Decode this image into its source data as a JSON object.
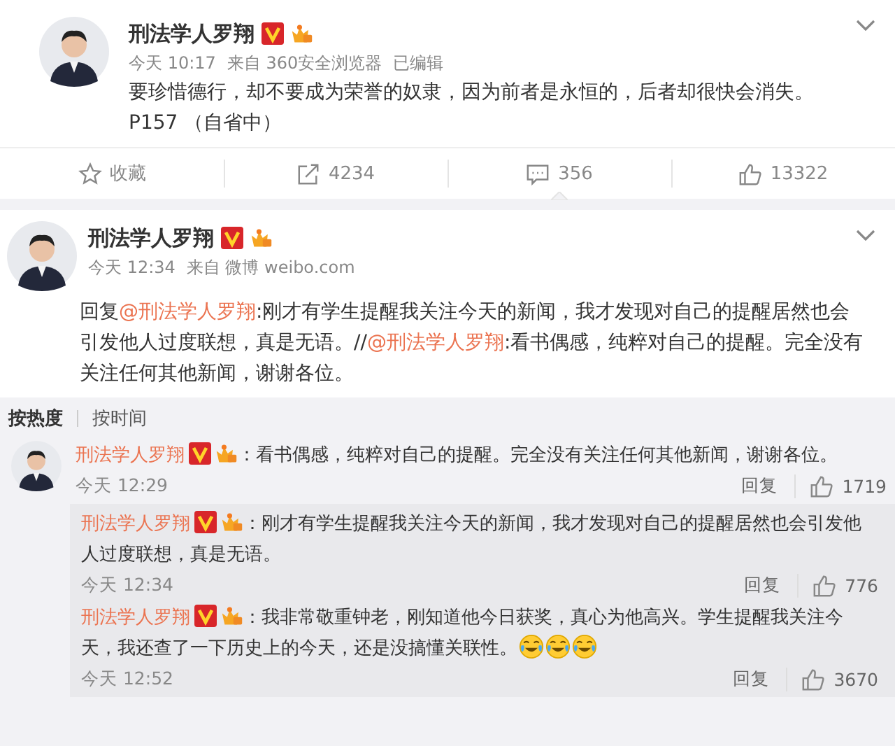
{
  "post": {
    "author": "刑法学人罗翔",
    "time": "今天 10:17",
    "source": "来自 360安全浏览器",
    "edited": "已编辑",
    "lines": [
      "要珍惜德行，却不要成为荣誉的奴隶，因为前者是永恒的，后者却很快会消失。",
      "P157 （自省中）"
    ],
    "actions": [
      {
        "kind": "favorite",
        "label": "收藏",
        "selected": false
      },
      {
        "kind": "repost",
        "label": "4234",
        "selected": false
      },
      {
        "kind": "comment",
        "label": "356",
        "selected": true
      },
      {
        "kind": "like",
        "label": "13322",
        "selected": false
      }
    ]
  },
  "repost": {
    "author": "刑法学人罗翔",
    "time": "今天 12:34",
    "source": "来自 微博 weibo.com",
    "segments": [
      {
        "kind": "text",
        "text": "回复"
      },
      {
        "kind": "mention",
        "text": "@刑法学人罗翔"
      },
      {
        "kind": "text",
        "text": ":刚才有学生提醒我关注今天的新闻，我才发现对自己的提醒居然也会引发他人过度联想，真是无语。//"
      },
      {
        "kind": "mention",
        "text": "@刑法学人罗翔"
      },
      {
        "kind": "text",
        "text": ":看书偶感，纯粹对自己的提醒。完全没有关注任何其他新闻，谢谢各位。"
      }
    ]
  },
  "sort_tabs": [
    {
      "label": "按热度",
      "selected": true
    },
    {
      "label": "按时间",
      "selected": false
    }
  ],
  "comment": {
    "author": "刑法学人罗翔",
    "text": "：看书偶感，纯粹对自己的提醒。完全没有关注任何其他新闻，谢谢各位。",
    "time": "今天 12:29",
    "reply": "回复",
    "likes": "1719"
  },
  "replies": [
    {
      "author": "刑法学人罗翔",
      "text": "：刚才有学生提醒我关注今天的新闻，我才发现对自己的提醒居然也会引发他人过度联想，真是无语。",
      "time": "今天 12:34",
      "reply": "回复",
      "likes": "776"
    },
    {
      "author": "刑法学人罗翔",
      "text": "：我非常敬重钟老，刚知道他今日获奖，真心为他高兴。学生提醒我关注今天，我还查了一下历史上的今天，还是没搞懂关联性。",
      "emojis": [
        {
          "kind": "laugh-cry"
        },
        {
          "kind": "laugh-cry"
        },
        {
          "kind": "laugh-cry"
        }
      ],
      "time": "今天 12:52",
      "reply": "回复",
      "likes": "3670"
    }
  ]
}
